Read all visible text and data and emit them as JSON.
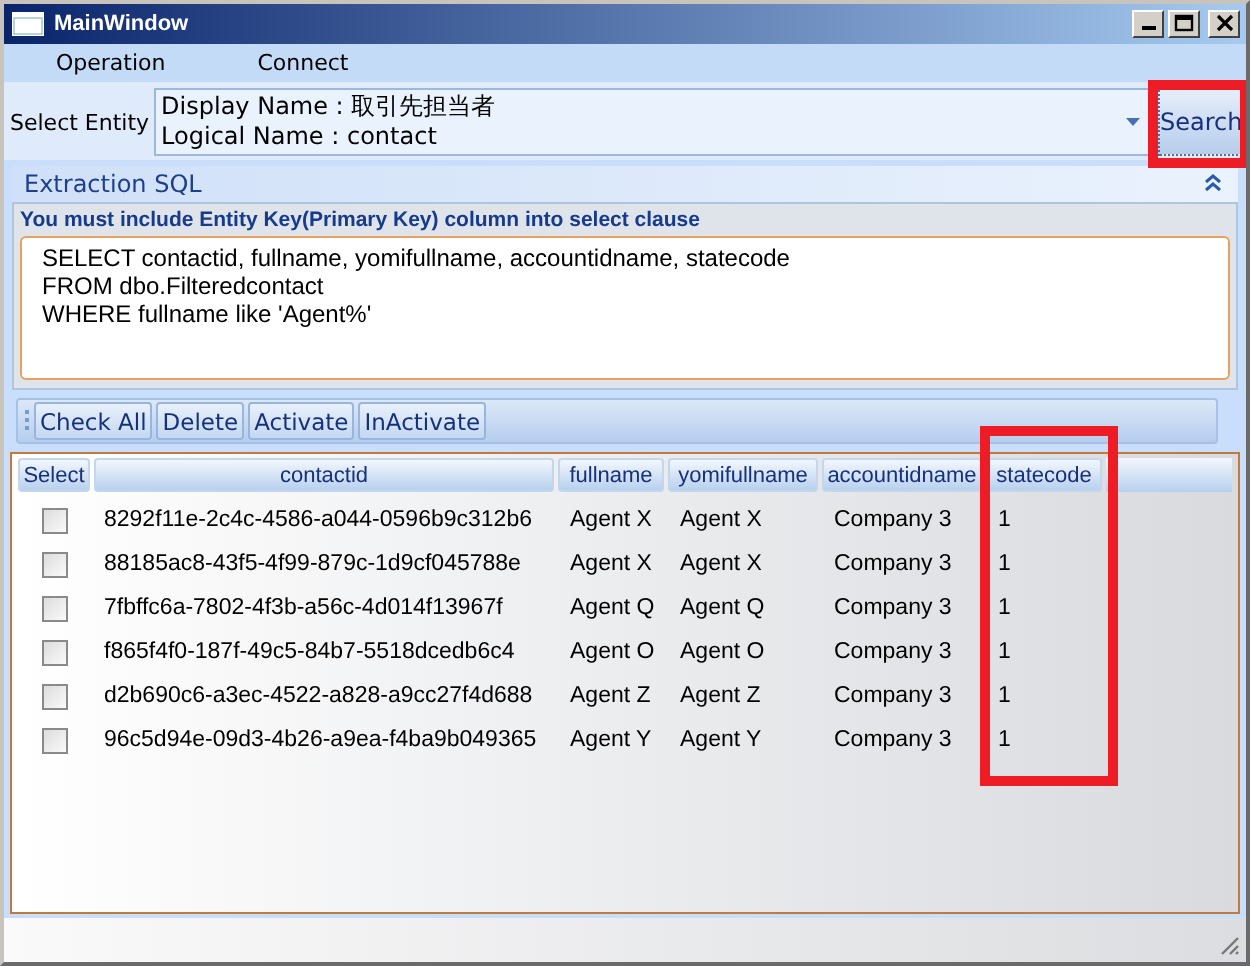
{
  "window": {
    "title": "MainWindow"
  },
  "menu": [
    "Operation",
    "Connect"
  ],
  "entity": {
    "label": "Select Entity",
    "lines": [
      "Display Name : 取引先担当者",
      "Logical Name : contact"
    ],
    "button": "Search"
  },
  "sql_panel": {
    "title": "Extraction SQL",
    "expanded": true,
    "hint": "You must include Entity Key(Primary Key) column into select clause",
    "query_lines": [
      "SELECT  contactid, fullname, yomifullname, accountidname, statecode",
      "FROM dbo.Filteredcontact",
      "WHERE fullname like 'Agent%'"
    ]
  },
  "toolbar": [
    "Check All",
    "Delete",
    "Activate",
    "InActivate"
  ],
  "grid": {
    "select_header": "Select",
    "columns": [
      "contactid",
      "fullname",
      "yomifullname",
      "accountidname",
      "statecode"
    ],
    "rows": [
      {
        "checked": false,
        "cells": [
          "8292f11e-2c4c-4586-a044-0596b9c312b6",
          "Agent X",
          "Agent X",
          "Company 3",
          "1"
        ]
      },
      {
        "checked": false,
        "cells": [
          "88185ac8-43f5-4f99-879c-1d9cf045788e",
          "Agent X",
          "Agent X",
          "Company 3",
          "1"
        ]
      },
      {
        "checked": false,
        "cells": [
          "7fbffc6a-7802-4f3b-a56c-4d014f13967f",
          "Agent Q",
          "Agent Q",
          "Company 3",
          "1"
        ]
      },
      {
        "checked": false,
        "cells": [
          "f865f4f0-187f-49c5-84b7-5518dcedb6c4",
          "Agent O",
          "Agent O",
          "Company 3",
          "1"
        ]
      },
      {
        "checked": false,
        "cells": [
          "d2b690c6-a3ec-4522-a828-a9cc27f4d688",
          "Agent Z",
          "Agent Z",
          "Company 3",
          "1"
        ]
      },
      {
        "checked": false,
        "cells": [
          "96c5d94e-09d3-4b26-a9ea-f4ba9b049365",
          "Agent Y",
          "Agent Y",
          "Company 3",
          "1"
        ]
      }
    ]
  }
}
